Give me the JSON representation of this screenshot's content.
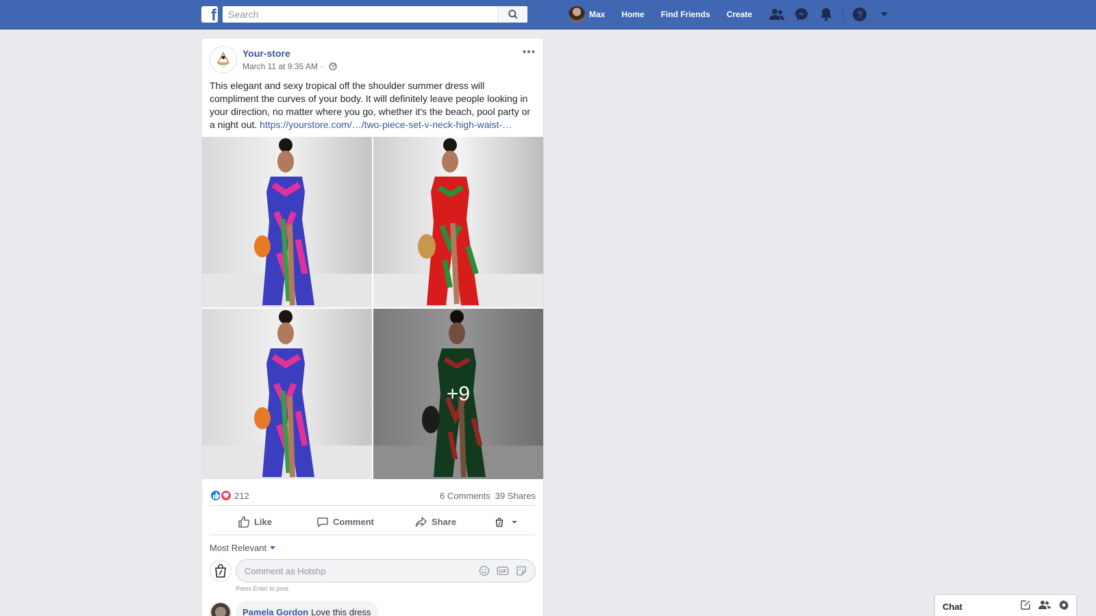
{
  "topbar": {
    "logo_letter": "f",
    "search_placeholder": "Search",
    "user_name": "Max",
    "nav": [
      "Home",
      "Find Friends",
      "Create"
    ],
    "brand_color": "#4267b2",
    "icons": [
      "friends-icon",
      "messenger-icon",
      "notifications-icon",
      "help-icon",
      "account-menu-icon"
    ]
  },
  "post": {
    "page_name": "Your-store",
    "timestamp": "March 11 at 9:35 AM",
    "separator": " · ",
    "text": "This elegant and sexy tropical off the shoulder summer dress will compliment the curves of your body. It will definitely leave people looking in your direction, no matter where you go, whether it's the beach, pool party or a night out.",
    "link": "https://yourstore.com/…/two-piece-set-v-neck-high-waist-…",
    "more_photos": "+9",
    "photos": [
      {
        "description_icon": "photo-tropical-blue-dress"
      },
      {
        "description_icon": "photo-tropical-red-dress"
      },
      {
        "description_icon": "photo-tropical-blue-dress"
      },
      {
        "description_icon": "photo-tropical-green-dress"
      }
    ],
    "reaction_count": "212",
    "comments_count": "6 Comments",
    "shares_count": "39 Shares",
    "actions": {
      "like": "Like",
      "comment": "Comment",
      "share": "Share"
    },
    "sort_label": "Most Relevant",
    "comment_placeholder": "Comment as Hotshp",
    "press_enter_hint": "Press Enter to post.",
    "comments": [
      {
        "author": "Pamela Gordon",
        "text": "Love this dress"
      }
    ]
  },
  "chat": {
    "label": "Chat"
  }
}
